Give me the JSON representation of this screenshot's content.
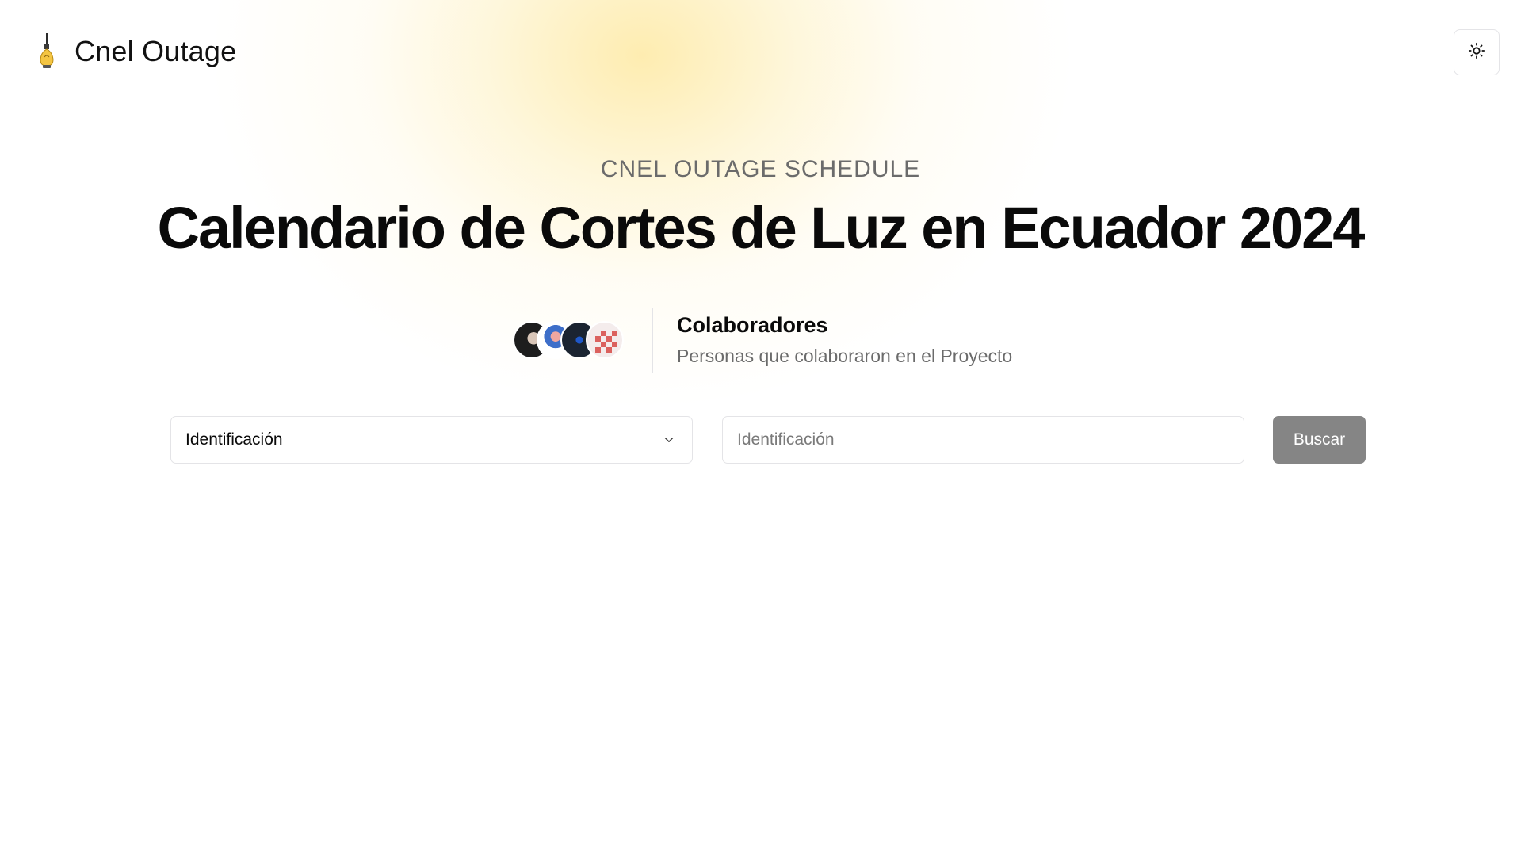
{
  "header": {
    "brand_name": "Cnel Outage",
    "logo_icon": "lightbulb-icon",
    "theme_toggle_icon": "sun-icon"
  },
  "hero": {
    "eyebrow": "CNEL OUTAGE SCHEDULE",
    "title": "Calendario de Cortes de Luz en Ecuador 2024"
  },
  "collaborators": {
    "title": "Colaboradores",
    "subtitle": "Personas que colaboraron en el Proyecto"
  },
  "search": {
    "select_value": "Identificación",
    "input_placeholder": "Identificación",
    "input_value": "",
    "button_label": "Buscar"
  },
  "colors": {
    "glow": "#fde696",
    "button_bg": "#858585",
    "border": "#e4e4e7",
    "muted_text": "#6b6b6b"
  }
}
